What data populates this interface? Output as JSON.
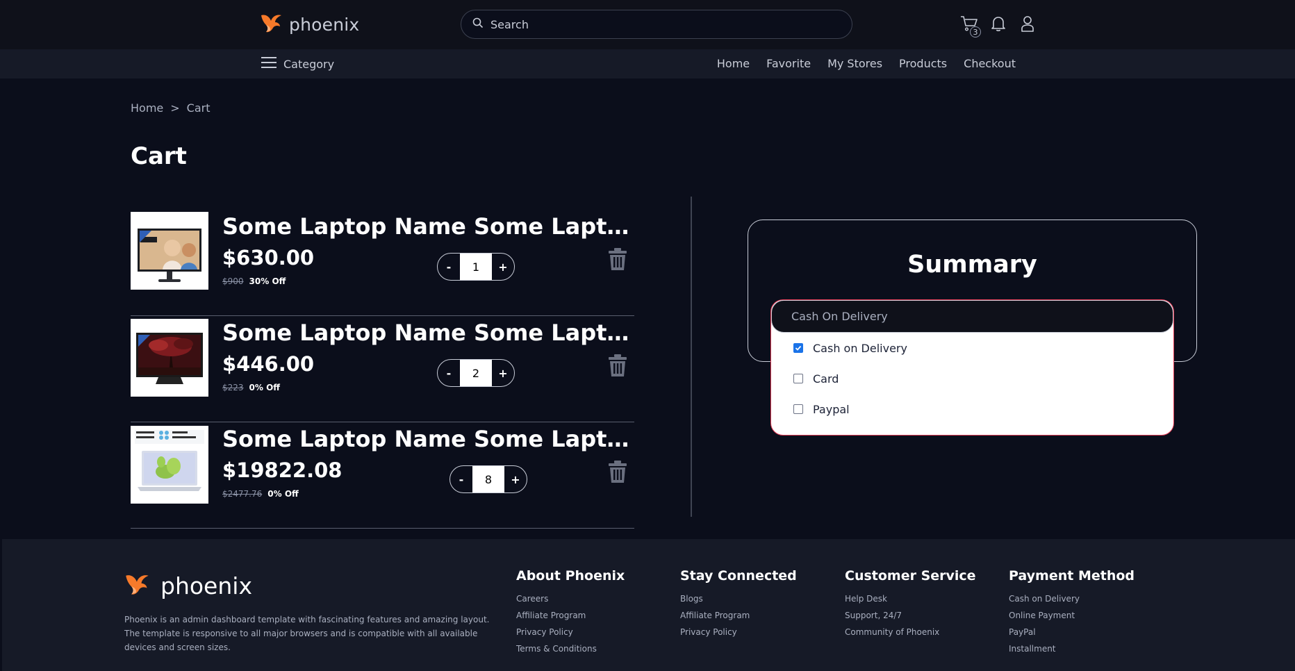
{
  "header": {
    "brand": "phoenix",
    "search_placeholder": "Search",
    "cart_count": "3"
  },
  "nav": {
    "category": "Category",
    "links": [
      "Home",
      "Favorite",
      "My Stores",
      "Products",
      "Checkout"
    ]
  },
  "breadcrumb": {
    "home": "Home",
    "separator": ">",
    "current": "Cart"
  },
  "page_title": "Cart",
  "cart": {
    "items": [
      {
        "name": "Some Laptop Name Some Laptop Name Some Laptop Name",
        "price": "$630.00",
        "old_price": "$900",
        "discount": "30% Off",
        "qty": "1",
        "image": "monitor-with-family-photo"
      },
      {
        "name": "Some Laptop Name Some Laptop Name Some Laptop Name",
        "price": "$446.00",
        "old_price": "$223",
        "discount": "0% Off",
        "qty": "2",
        "image": "monitor-with-tree-wallpaper"
      },
      {
        "name": "Some Laptop Name Some Laptop Name Some Laptop Name",
        "price": "$19822.08",
        "old_price": "$2477.76",
        "discount": "0% Off",
        "qty": "8",
        "image": "laptop-with-green-wallpaper"
      }
    ],
    "decrement_label": "-",
    "increment_label": "+"
  },
  "summary": {
    "title": "Summary",
    "payment_selected": "Cash On Delivery",
    "options": [
      {
        "label": "Cash on Delivery",
        "checked": true
      },
      {
        "label": "Card",
        "checked": false
      },
      {
        "label": "Paypal",
        "checked": false
      }
    ]
  },
  "footer": {
    "brand": "phoenix",
    "description": "Phoenix is an admin dashboard template with fascinating features and amazing layout. The template is responsive to all major browsers and is compatible with all available devices and screen sizes.",
    "columns": [
      {
        "title": "About Phoenix",
        "links": [
          "Careers",
          "Affiliate Program",
          "Privacy Policy",
          "Terms & Conditions"
        ]
      },
      {
        "title": "Stay Connected",
        "links": [
          "Blogs",
          "Affiliate Program",
          "Privacy Policy"
        ]
      },
      {
        "title": "Customer Service",
        "links": [
          "Help Desk",
          "Support, 24/7",
          "Community of Phoenix"
        ]
      },
      {
        "title": "Payment Method",
        "links": [
          "Cash on Delivery",
          "Online Payment",
          "PayPal",
          "Installment"
        ]
      }
    ]
  },
  "colors": {
    "background": "#0b0e1b",
    "accent_orange": "#f77a2a",
    "checkbox_blue": "#1a73e8",
    "dropdown_border": "#e53a54"
  }
}
